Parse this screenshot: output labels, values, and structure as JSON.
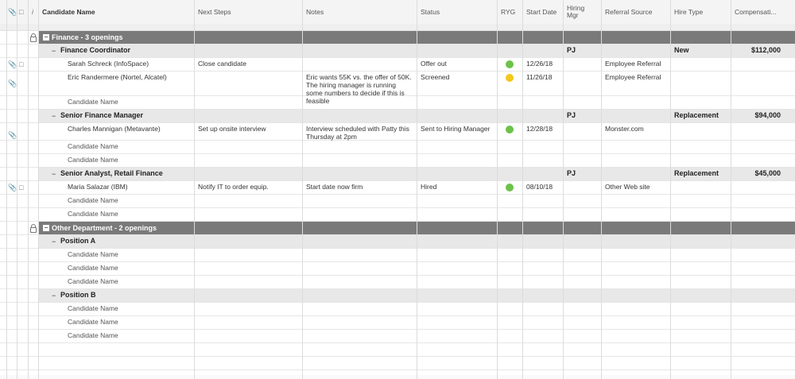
{
  "header": {
    "icons": [
      "paperclip-icon",
      "comment-icon",
      "info-icon"
    ],
    "info_glyph": "i",
    "candidate_name": "Candidate Name",
    "next_steps": "Next Steps",
    "notes": "Notes",
    "status": "Status",
    "ryg": "RYG",
    "start_date": "Start Date",
    "hiring_mgr_1": "Hiring",
    "hiring_mgr_2": "Mgr",
    "referral_source": "Referral Source",
    "hire_type": "Hire Type",
    "compensation": "Compensati..."
  },
  "colors": {
    "green": "#6cc24a",
    "yellow": "#f2c81c",
    "group_bg": "#7a7a7a",
    "sub_bg": "#e8e8e8"
  },
  "groups": [
    {
      "title": "Finance - 3 openings",
      "positions": [
        {
          "title": "Finance Coordinator",
          "hiring_mgr": "PJ",
          "hire_type": "New",
          "compensation": "$112,000",
          "candidates": [
            {
              "name": "Sarah Schreck (InfoSpace)",
              "next_steps": "Close candidate",
              "notes": "",
              "status": "Offer out",
              "ryg": "green",
              "start_date": "12/26/18",
              "referral": "Employee Referral",
              "icons": [
                "paperclip-icon",
                "comment-icon"
              ]
            },
            {
              "name": "Eric Randermere (Nortel, Alcatel)",
              "next_steps": "",
              "notes": "Eric wants 55K vs. the offer of 50K. The hiring manager is running some numbers to decide if this is feasible",
              "status": "Screened",
              "ryg": "yellow",
              "start_date": "11/26/18",
              "referral": "Employee Referral",
              "icons": [
                "paperclip-icon"
              ]
            },
            {
              "name": "Candidate Name"
            }
          ]
        },
        {
          "title": "Senior Finance Manager",
          "hiring_mgr": "PJ",
          "hire_type": "Replacement",
          "compensation": "$94,000",
          "candidates": [
            {
              "name": "Charles Mannigan (Metavante)",
              "next_steps": "Set up onsite interview",
              "notes": "Interview scheduled with Patty this Thursday at 2pm",
              "status": "Sent to Hiring Manager",
              "ryg": "green",
              "start_date": "12/28/18",
              "referral": "Monster.com",
              "icons": [
                "paperclip-icon"
              ]
            },
            {
              "name": "Candidate Name"
            },
            {
              "name": "Candidate Name"
            }
          ]
        },
        {
          "title": "Senior Analyst, Retail Finance",
          "hiring_mgr": "PJ",
          "hire_type": "Replacement",
          "compensation": "$45,000",
          "candidates": [
            {
              "name": "Maria Salazar (IBM)",
              "next_steps": "Notify IT to order equip.",
              "notes": "Start date now firm",
              "status": "Hired",
              "ryg": "green",
              "start_date": "08/10/18",
              "referral": "Other Web site",
              "icons": [
                "paperclip-icon",
                "comment-icon"
              ]
            },
            {
              "name": "Candidate Name"
            },
            {
              "name": "Candidate Name"
            }
          ]
        }
      ]
    },
    {
      "title": "Other Department - 2 openings",
      "positions": [
        {
          "title": "Position A",
          "candidates": [
            {
              "name": "Candidate Name"
            },
            {
              "name": "Candidate Name"
            },
            {
              "name": "Candidate Name"
            }
          ]
        },
        {
          "title": "Position B",
          "candidates": [
            {
              "name": "Candidate Name"
            },
            {
              "name": "Candidate Name"
            },
            {
              "name": "Candidate Name"
            }
          ]
        }
      ]
    }
  ]
}
